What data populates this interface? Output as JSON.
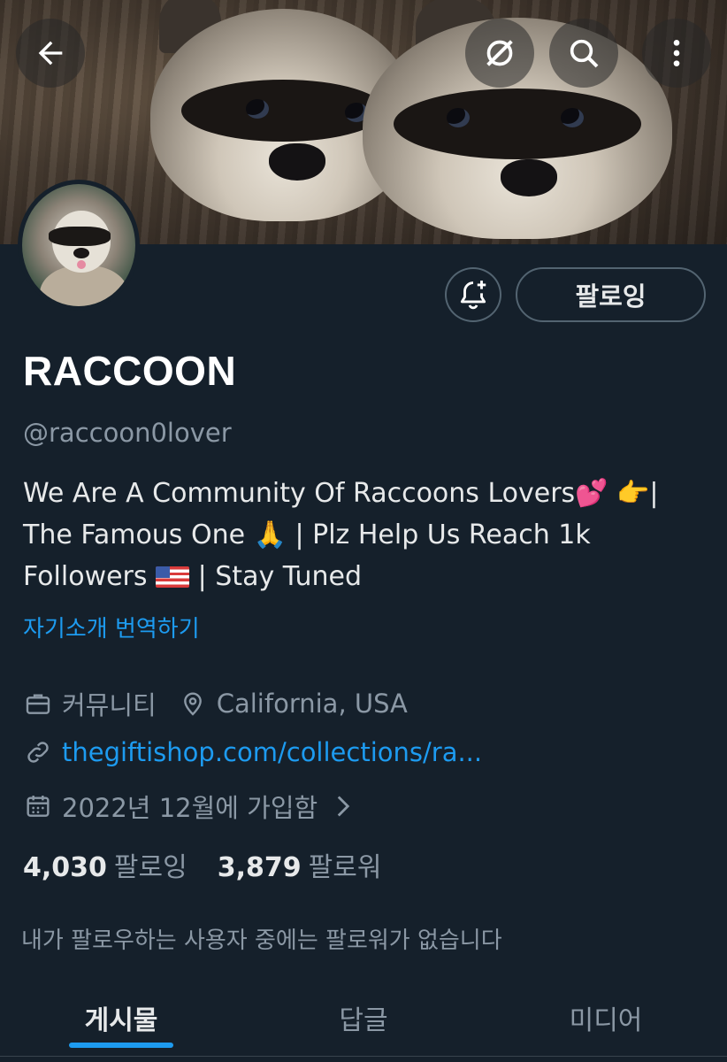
{
  "header": {
    "back_icon": "arrow-left-icon",
    "grok_icon": "grok-icon",
    "search_icon": "search-icon",
    "more_icon": "more-vertical-icon"
  },
  "profile": {
    "display_name": "RACCOON",
    "handle": "@raccoon0lover",
    "bio_line1": "We Are A Community Of Raccoons Lovers💕  👉|",
    "bio_line2": "The Famous One 🙏 | Plz Help Us Reach 1k",
    "bio_line3_a": "Followers",
    "bio_line3_b": "| Stay Tuned",
    "translate_label": "자기소개 번역하기",
    "category": "커뮤니티",
    "location": "California, USA",
    "website": "thegiftishop.com/collections/ra...",
    "joined": "2022년 12월에 가입함"
  },
  "actions": {
    "notify_icon": "bell-plus-icon",
    "follow_label": "팔로잉"
  },
  "stats": {
    "following_count": "4,030",
    "following_label": "팔로잉",
    "followers_count": "3,879",
    "followers_label": "팔로워"
  },
  "followers_note": "내가 팔로우하는 사용자 중에는 팔로워가 없습니다",
  "tabs": [
    {
      "label": "게시물",
      "active": true
    },
    {
      "label": "답글",
      "active": false
    },
    {
      "label": "미디어",
      "active": false
    }
  ],
  "colors": {
    "background": "#15202b",
    "accent": "#1d9bf0",
    "muted_text": "#8b98a5"
  }
}
